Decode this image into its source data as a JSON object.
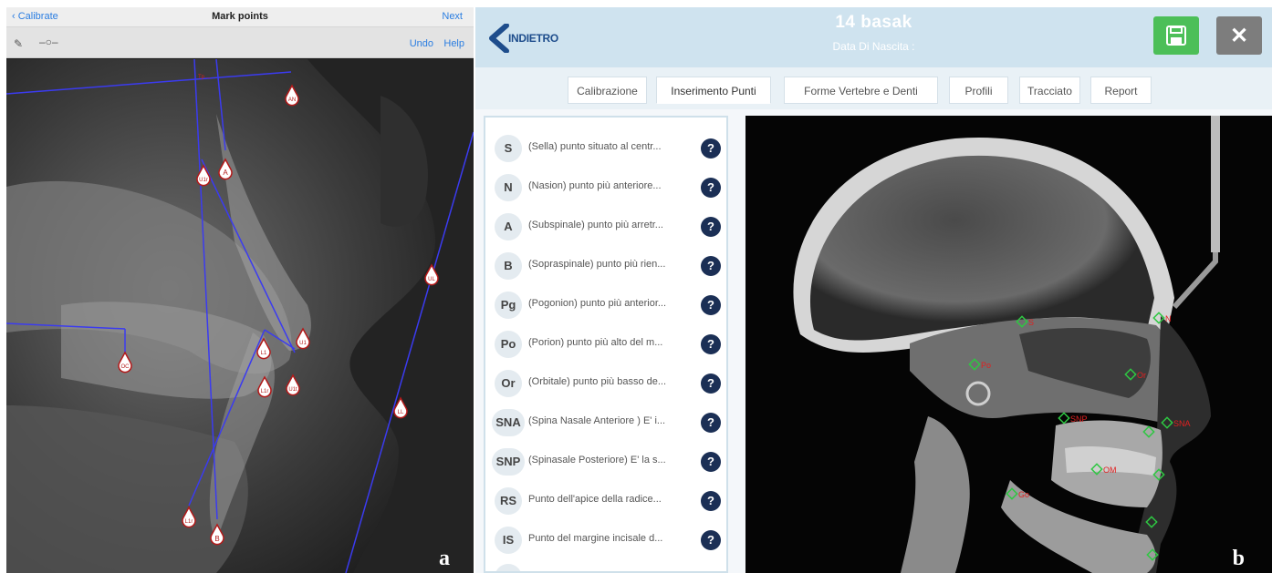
{
  "panel_a": {
    "nav": {
      "back_label": "Calibrate",
      "title": "Mark points",
      "next_label": "Next"
    },
    "toolbar": {
      "undo_label": "Undo",
      "help_label": "Help",
      "pencil_icon": "pencil-icon",
      "marker_icon": "marker-line-icon"
    },
    "marker_labels": [
      "AN",
      "U1r",
      "A",
      "UL",
      "U1",
      "L1",
      "OC",
      "L1r",
      "U1t",
      "LL",
      "L1r",
      "B"
    ],
    "panel_letter": "a"
  },
  "panel_b": {
    "header": {
      "back_label": "INDIETRO",
      "patient_name": "14  basak",
      "dob_label": "Data Di Nascita :"
    },
    "colors": {
      "header_bg": "#cfe3ef",
      "save": "#4cbf58",
      "close": "#7d7d7d",
      "help_badge": "#1b2f55",
      "landmark": "#2ec742",
      "landmark_label": "#e02020"
    },
    "tabs": [
      "Calibrazione",
      "Inserimento Punti",
      "Forme Vertebre e Denti",
      "Profili",
      "Tracciato",
      "Report"
    ],
    "points": [
      {
        "code": "S",
        "desc": "(Sella) punto situato al centr..."
      },
      {
        "code": "N",
        "desc": "(Nasion) punto più anteriore..."
      },
      {
        "code": "A",
        "desc": "(Subspinale) punto più arretr..."
      },
      {
        "code": "B",
        "desc": "(Sopraspinale) punto più rien..."
      },
      {
        "code": "Pg",
        "desc": "(Pogonion) punto più anterior..."
      },
      {
        "code": "Po",
        "desc": "(Porion) punto più alto del m..."
      },
      {
        "code": "Or",
        "desc": "(Orbitale) punto più basso de..."
      },
      {
        "code": "SNA",
        "desc": "(Spina  Nasale Anteriore ) E' i..."
      },
      {
        "code": "SNP",
        "desc": "(Spinasale Posteriore) E' la s..."
      },
      {
        "code": "RS",
        "desc": "Punto dell'apice della radice..."
      },
      {
        "code": "IS",
        "desc": "Punto del margine incisale d..."
      }
    ],
    "help_glyph": "?",
    "landmarks": [
      "S",
      "N",
      "Po",
      "Or",
      "SNP",
      "SNA",
      "OM",
      "Go"
    ],
    "panel_letter": "b"
  }
}
